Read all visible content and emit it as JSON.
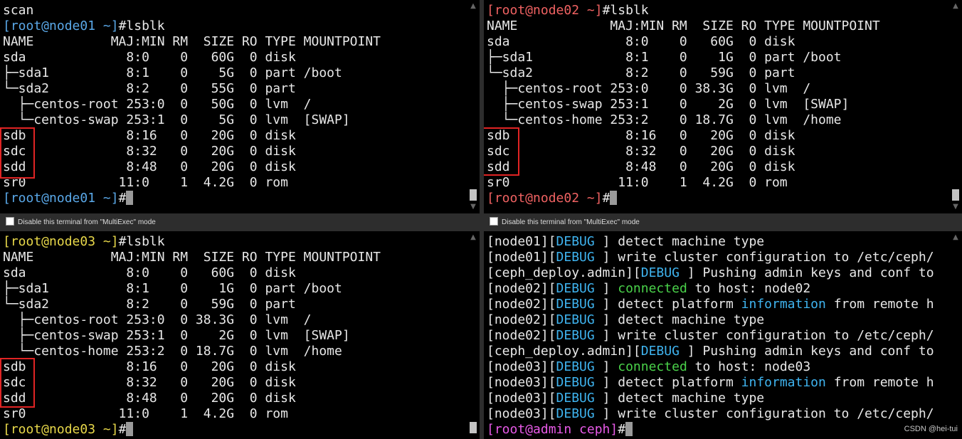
{
  "panes": [
    {
      "name": "node01",
      "lines": [
        [
          [
            "scan",
            ""
          ]
        ],
        [
          [
            "[root@node01 ~]",
            "c-blue"
          ],
          [
            "#lsblk",
            ""
          ]
        ],
        [
          [
            "NAME          MAJ:MIN RM  SIZE RO TYPE MOUNTPOINT",
            ""
          ]
        ],
        [
          [
            "sda             8:0    0   60G  0 disk",
            ""
          ]
        ],
        [
          [
            "├─sda1          8:1    0    5G  0 part /boot",
            ""
          ]
        ],
        [
          [
            "└─sda2          8:2    0   55G  0 part",
            ""
          ]
        ],
        [
          [
            "  ├─centos-root 253:0  0   50G  0 lvm  /",
            ""
          ]
        ],
        [
          [
            "  └─centos-swap 253:1  0    5G  0 lvm  [SWAP]",
            ""
          ]
        ],
        [
          [
            "sdb             8:16   0   20G  0 disk",
            ""
          ]
        ],
        [
          [
            "sdc             8:32   0   20G  0 disk",
            ""
          ]
        ],
        [
          [
            "sdd             8:48   0   20G  0 disk",
            ""
          ]
        ],
        [
          [
            "sr0            11:0    1  4.2G  0 rom",
            ""
          ]
        ],
        [
          [
            "[root@node01 ~]",
            "c-blue"
          ],
          [
            "#",
            ""
          ]
        ]
      ]
    },
    {
      "name": "node02",
      "lines": [
        [
          [
            "[root@node02 ~]",
            "c-red"
          ],
          [
            "#lsblk",
            ""
          ]
        ],
        [
          [
            "NAME            MAJ:MIN RM  SIZE RO TYPE MOUNTPOINT",
            ""
          ]
        ],
        [
          [
            "sda               8:0    0   60G  0 disk",
            ""
          ]
        ],
        [
          [
            "├─sda1            8:1    0    1G  0 part /boot",
            ""
          ]
        ],
        [
          [
            "└─sda2            8:2    0   59G  0 part",
            ""
          ]
        ],
        [
          [
            "  ├─centos-root 253:0    0 38.3G  0 lvm  /",
            ""
          ]
        ],
        [
          [
            "  ├─centos-swap 253:1    0    2G  0 lvm  [SWAP]",
            ""
          ]
        ],
        [
          [
            "  └─centos-home 253:2    0 18.7G  0 lvm  /home",
            ""
          ]
        ],
        [
          [
            "sdb               8:16   0   20G  0 disk",
            ""
          ]
        ],
        [
          [
            "sdc               8:32   0   20G  0 disk",
            ""
          ]
        ],
        [
          [
            "sdd               8:48   0   20G  0 disk",
            ""
          ]
        ],
        [
          [
            "sr0              11:0    1  4.2G  0 rom",
            ""
          ]
        ],
        [
          [
            "[root@node02 ~]",
            "c-red"
          ],
          [
            "#",
            ""
          ]
        ]
      ]
    },
    {
      "name": "node03",
      "lines": [
        [
          [
            "[root@node03 ~]",
            "c-yellow"
          ],
          [
            "#lsblk",
            ""
          ]
        ],
        [
          [
            "NAME          MAJ:MIN RM  SIZE RO TYPE MOUNTPOINT",
            ""
          ]
        ],
        [
          [
            "sda             8:0    0   60G  0 disk",
            ""
          ]
        ],
        [
          [
            "├─sda1          8:1    0    1G  0 part /boot",
            ""
          ]
        ],
        [
          [
            "└─sda2          8:2    0   59G  0 part",
            ""
          ]
        ],
        [
          [
            "  ├─centos-root 253:0  0 38.3G  0 lvm  /",
            ""
          ]
        ],
        [
          [
            "  ├─centos-swap 253:1  0    2G  0 lvm  [SWAP]",
            ""
          ]
        ],
        [
          [
            "  └─centos-home 253:2  0 18.7G  0 lvm  /home",
            ""
          ]
        ],
        [
          [
            "sdb             8:16   0   20G  0 disk",
            ""
          ]
        ],
        [
          [
            "sdc             8:32   0   20G  0 disk",
            ""
          ]
        ],
        [
          [
            "sdd             8:48   0   20G  0 disk",
            ""
          ]
        ],
        [
          [
            "sr0            11:0    1  4.2G  0 rom",
            ""
          ]
        ],
        [
          [
            "[root@node03 ~]",
            "c-yellow"
          ],
          [
            "#",
            ""
          ]
        ]
      ]
    },
    {
      "name": "admin",
      "lines": [
        [
          [
            "[node01][",
            ""
          ],
          [
            "DEBUG",
            "c-cyan"
          ],
          [
            " ] detect machine type",
            ""
          ]
        ],
        [
          [
            "[node01][",
            ""
          ],
          [
            "DEBUG",
            "c-cyan"
          ],
          [
            " ] write cluster configuration to /etc/ceph/",
            ""
          ]
        ],
        [
          [
            "[ceph_deploy.admin][",
            ""
          ],
          [
            "DEBUG",
            "c-cyan"
          ],
          [
            " ] Pushing admin keys and conf to",
            ""
          ]
        ],
        [
          [
            "[node02][",
            ""
          ],
          [
            "DEBUG",
            "c-cyan"
          ],
          [
            " ] ",
            ""
          ],
          [
            "connected",
            "c-green"
          ],
          [
            " to host: node02",
            ""
          ]
        ],
        [
          [
            "[node02][",
            ""
          ],
          [
            "DEBUG",
            "c-cyan"
          ],
          [
            " ] detect platform ",
            ""
          ],
          [
            "information",
            "c-cyan"
          ],
          [
            " from remote h",
            ""
          ]
        ],
        [
          [
            "[node02][",
            ""
          ],
          [
            "DEBUG",
            "c-cyan"
          ],
          [
            " ] detect machine type",
            ""
          ]
        ],
        [
          [
            "[node02][",
            ""
          ],
          [
            "DEBUG",
            "c-cyan"
          ],
          [
            " ] write cluster configuration to /etc/ceph/",
            ""
          ]
        ],
        [
          [
            "[ceph_deploy.admin][",
            ""
          ],
          [
            "DEBUG",
            "c-cyan"
          ],
          [
            " ] Pushing admin keys and conf to",
            ""
          ]
        ],
        [
          [
            "[node03][",
            ""
          ],
          [
            "DEBUG",
            "c-cyan"
          ],
          [
            " ] ",
            ""
          ],
          [
            "connected",
            "c-green"
          ],
          [
            " to host: node03",
            ""
          ]
        ],
        [
          [
            "[node03][",
            ""
          ],
          [
            "DEBUG",
            "c-cyan"
          ],
          [
            " ] detect platform ",
            ""
          ],
          [
            "information",
            "c-cyan"
          ],
          [
            " from remote h",
            ""
          ]
        ],
        [
          [
            "[node03][",
            ""
          ],
          [
            "DEBUG",
            "c-cyan"
          ],
          [
            " ] detect machine type",
            ""
          ]
        ],
        [
          [
            "[node03][",
            ""
          ],
          [
            "DEBUG",
            "c-cyan"
          ],
          [
            " ] write cluster configuration to /etc/ceph/",
            ""
          ]
        ],
        [
          [
            "[root@admin ceph]",
            "c-magenta"
          ],
          [
            "#",
            ""
          ]
        ]
      ]
    }
  ],
  "multiexec_label": "Disable this terminal from \"MultiExec\" mode",
  "watermark": "CSDN @hei-tui",
  "colors": {
    "background": "#000000",
    "frame": "#2d2d2d",
    "highlight": "#e02424"
  }
}
